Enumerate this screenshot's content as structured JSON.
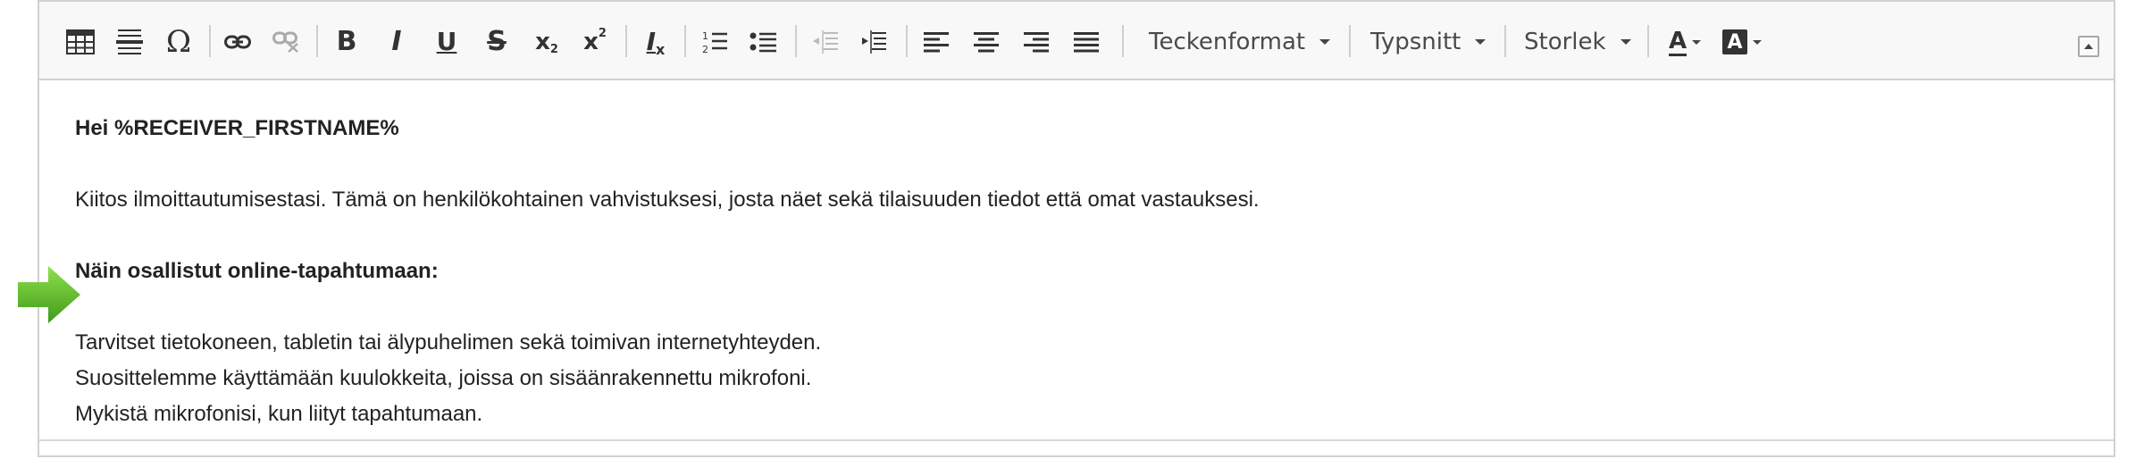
{
  "toolbar": {
    "buttons": [
      {
        "name": "table-icon"
      },
      {
        "name": "horizontal-line-icon"
      },
      {
        "name": "special-character-icon",
        "glyph": "Ω"
      },
      {
        "name": "link-icon"
      },
      {
        "name": "unlink-icon"
      },
      {
        "name": "bold-icon",
        "glyph": "B"
      },
      {
        "name": "italic-icon",
        "glyph": "I"
      },
      {
        "name": "underline-icon",
        "glyph": "U"
      },
      {
        "name": "strikethrough-icon",
        "glyph": "S"
      },
      {
        "name": "subscript-icon",
        "glyph": "x",
        "sub": "2"
      },
      {
        "name": "superscript-icon",
        "glyph": "x",
        "sup": "2"
      },
      {
        "name": "remove-format-icon",
        "glyph": "I",
        "sub": "x"
      },
      {
        "name": "numbered-list-icon"
      },
      {
        "name": "bulleted-list-icon"
      },
      {
        "name": "decrease-indent-icon"
      },
      {
        "name": "increase-indent-icon"
      },
      {
        "name": "align-left-icon"
      },
      {
        "name": "align-center-icon"
      },
      {
        "name": "align-right-icon"
      },
      {
        "name": "justify-icon"
      },
      {
        "name": "text-color-icon",
        "glyph": "A"
      },
      {
        "name": "background-color-icon",
        "glyph": "A"
      }
    ],
    "format_label": "Teckenformat",
    "font_label": "Typsnitt",
    "size_label": "Storlek"
  },
  "content": {
    "greeting": "Hei %RECEIVER_FIRSTNAME%",
    "intro": "Kiitos ilmoittautumisestasi. Tämä on henkilökohtainen vahvistuksesi, josta näet sekä tilaisuuden tiedot että omat vastauksesi.",
    "heading": "Näin osallistut online-tapahtumaan:",
    "lines": [
      "Tarvitset tietokoneen, tabletin tai älypuhelimen sekä toimivan internetyhteyden.",
      "Suosittelemme käyttämään kuulokkeita, joissa on sisäänrakennettu mikrofoni.",
      "Mykistä mikrofonisi, kun liityt tapahtumaan."
    ]
  },
  "colors": {
    "arrow": "#5cb82a",
    "toolbar_bg": "#f8f8f8",
    "border": "#d1d1d1"
  }
}
